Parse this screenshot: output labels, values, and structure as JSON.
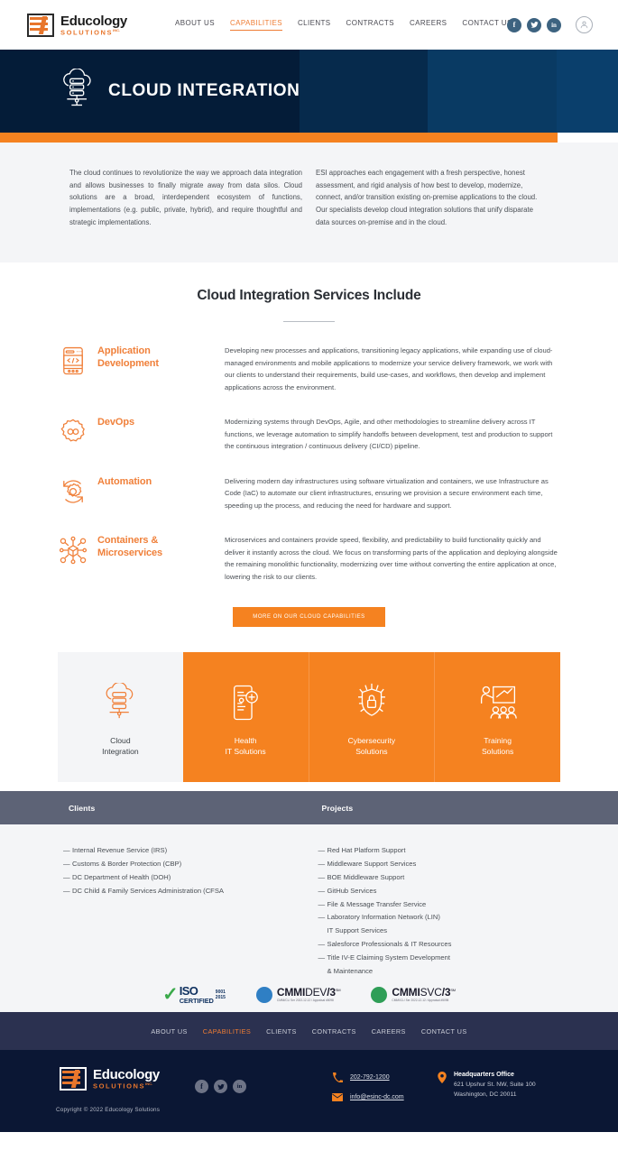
{
  "header": {
    "logo": {
      "name": "Educology",
      "sub": "SOLUTIONS",
      "sup": "INC."
    },
    "nav": [
      {
        "label": "ABOUT US",
        "active": false
      },
      {
        "label": "CAPABILITIES",
        "active": true
      },
      {
        "label": "CLIENTS",
        "active": false
      },
      {
        "label": "CONTRACTS",
        "active": false
      },
      {
        "label": "CAREERS",
        "active": false
      },
      {
        "label": "CONTACT US",
        "active": false
      }
    ],
    "social": [
      {
        "icon": "facebook-icon",
        "glyph": "f"
      },
      {
        "icon": "twitter-icon",
        "glyph": "ᴠ"
      },
      {
        "icon": "linkedin-icon",
        "glyph": "in"
      }
    ],
    "account_icon": "user-account-icon"
  },
  "hero": {
    "title": "CLOUD INTEGRATION",
    "icon": "cloud-server-icon",
    "accent_color": "#f58220",
    "band_colors": [
      "#041c38",
      "#062a4c",
      "#093a63",
      "#0a3f6c"
    ]
  },
  "intro": {
    "left": "The cloud continues to revolutionize the way we approach data integration and allows businesses to finally migrate away from data silos. Cloud solutions are a broad, interdependent ecosystem of functions, implementations (e.g. public, private, hybrid), and require thoughtful and strategic implementations.",
    "right": "ESI approaches each engagement with a fresh perspective, honest assessment, and rigid analysis of how best to develop, modernize, connect, and/or transition existing on-premise applications to the cloud. Our specialists develop cloud integration solutions that unify disparate data sources on-premise and in the cloud."
  },
  "services": {
    "title": "Cloud Integration Services Include",
    "items": [
      {
        "name": "Application\nDevelopment",
        "name_l1": "Application",
        "name_l2": "Development",
        "icon": "mobile-code-icon",
        "desc": "Developing new processes and applications, transitioning legacy applications, while expanding use of cloud-managed environments and mobile applications to modernize your service delivery framework, we work with our clients to understand their requirements, build use-cases, and workflows, then develop and implement applications across the environment."
      },
      {
        "name_l1": "DevOps",
        "name_l2": "",
        "icon": "gear-infinity-icon",
        "desc": "Modernizing systems through DevOps, Agile, and other methodologies to streamline delivery across IT functions, we leverage automation to simplify handoffs between development, test and production to support the continuous integration / continuous delivery (CI/CD) pipeline."
      },
      {
        "name_l1": "Automation",
        "name_l2": "",
        "icon": "gear-refresh-icon",
        "desc": "Delivering modern day infrastructures using software virtualization and containers, we use Infrastructure as Code (IaC) to automate our client infrastructures, ensuring we provision a secure environment each time, speeding up the process, and reducing the need for hardware and support."
      },
      {
        "name_l1": "Containers &",
        "name_l2": "Microservices",
        "icon": "container-nodes-icon",
        "desc": "Microservices and containers provide speed, flexibility, and predictability to build functionality quickly and deliver it instantly across the cloud. We focus on transforming parts of the application and deploying alongside the remaining monolithic functionality, modernizing over time without converting the entire application at once, lowering the risk to our clients."
      }
    ],
    "cta_label": "MORE ON OUR CLOUD CAPABILITIES"
  },
  "tiles": [
    {
      "l1": "Cloud",
      "l2": "Integration",
      "icon": "cloud-server-icon",
      "state": "active"
    },
    {
      "l1": "Health",
      "l2": "IT Solutions",
      "icon": "health-mobile-icon",
      "state": "orange"
    },
    {
      "l1": "Cybersecurity",
      "l2": "Solutions",
      "icon": "shield-lock-icon",
      "state": "orange"
    },
    {
      "l1": "Training",
      "l2": "Solutions",
      "icon": "training-board-icon",
      "state": "orange"
    }
  ],
  "clients": {
    "heading": "Clients",
    "items": [
      "Internal Revenue Service (IRS)",
      "Customs & Border Protection (CBP)",
      "DC Department of Health (DOH)",
      "DC Child & Family Services Administration (CFSA"
    ]
  },
  "projects": {
    "heading": "Projects",
    "items": [
      "Red Hat Platform Support",
      "Middleware Support Services",
      "BOE Middleware Support",
      "GitHub Services",
      "File & Message Transfer Service",
      "Laboratory Information Network (LIN)\nIT Support Services",
      "Salesforce Professionals & IT Resources",
      "Title IV-E Claiming System Development\n& Maintenance"
    ]
  },
  "certifications": [
    {
      "type": "iso",
      "icon": "green-check-icon",
      "t1": "ISO",
      "t2": "CERTIFIED",
      "year1": "9001",
      "year2": "2015"
    },
    {
      "type": "cmmi",
      "icon": "cmmi-globe-blue-icon",
      "bold": "CMMI",
      "light": "DEV",
      "level": "/3",
      "sup": "SM",
      "sub": "CMMI/CL/ Ser 2022-12-12 / Appraisal #5098"
    },
    {
      "type": "cmmi",
      "icon": "cmmi-globe-green-icon",
      "bold": "CMMI",
      "light": "SVC",
      "level": "/3",
      "sup": "SM",
      "sub": "CMMI/CL/ Ser 2022-12-12 / Appraisal #5098"
    }
  ],
  "footer": {
    "nav": [
      {
        "label": "ABOUT US",
        "active": false
      },
      {
        "label": "CAPABILITIES",
        "active": true
      },
      {
        "label": "CLIENTS",
        "active": false
      },
      {
        "label": "CONTRACTS",
        "active": false
      },
      {
        "label": "CAREERS",
        "active": false
      },
      {
        "label": "CONTACT US",
        "active": false
      }
    ],
    "logo": {
      "name": "Educology",
      "sub": "SOLUTIONS",
      "sup": "INC."
    },
    "copyright": "Copyright © 2022 Educology Solutions",
    "social": [
      {
        "icon": "facebook-icon",
        "glyph": "f"
      },
      {
        "icon": "twitter-icon",
        "glyph": "ᴠ"
      },
      {
        "icon": "linkedin-icon",
        "glyph": "in"
      }
    ],
    "phone": "202-792-1200",
    "phone_icon": "phone-icon",
    "email": "info@esinc-dc.com",
    "email_icon": "envelope-icon",
    "address_icon": "map-pin-icon",
    "address_title": "Headquarters Office",
    "address_line1": "621 Upshur St. NW, Suite 100",
    "address_line2": "Washington, DC 20011"
  }
}
